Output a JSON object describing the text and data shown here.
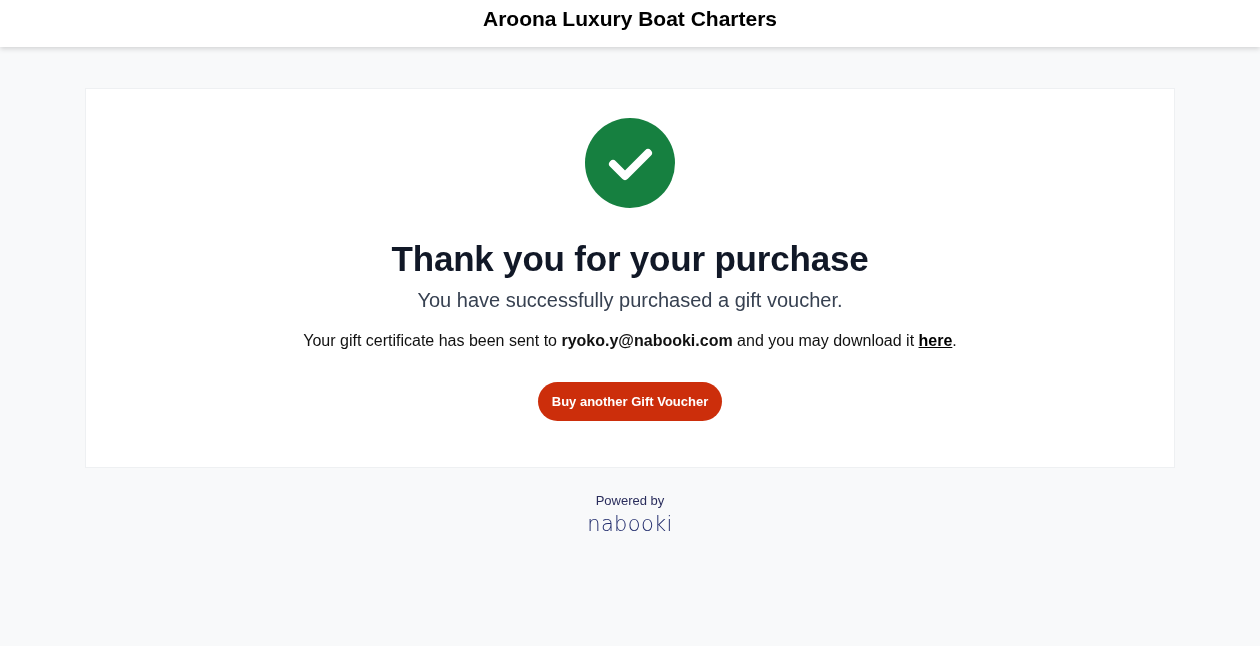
{
  "header": {
    "title": "Aroona Luxury Boat Charters"
  },
  "confirmation": {
    "kind": "success",
    "heading": "Thank you for your purchase",
    "subheading": "You have successfully purchased a gift voucher.",
    "message": {
      "before": "Your gift certificate has been sent to **ryoko.y@nabooki.com** and you may download it ",
      "link": "here",
      "after": "."
    },
    "button": "Buy another Gift Voucher"
  },
  "footer": {
    "powered_by": "Powered by",
    "logo": "nabooki"
  }
}
